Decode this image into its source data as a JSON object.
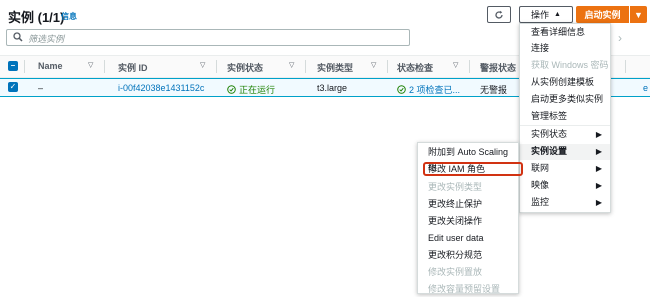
{
  "header": {
    "title": "实例 (1/1)",
    "info": "信息",
    "actions_label": "操作",
    "launch_label": "启动实例"
  },
  "search": {
    "placeholder": "筛选实例"
  },
  "table": {
    "columns": [
      "Name",
      "实例 ID",
      "实例状态",
      "实例类型",
      "状态检查",
      "警报状态"
    ],
    "row": {
      "name": "–",
      "instance_id": "i-00f42038e1431152c",
      "state": "正在运行",
      "type": "t3.large",
      "status_check": "2 项检查已...",
      "alarm": "无警报",
      "extra": "e"
    }
  },
  "actions_menu": [
    {
      "label": "查看详细信息",
      "disabled": false,
      "submenu": false
    },
    {
      "label": "连接",
      "disabled": false,
      "submenu": false
    },
    {
      "label": "获取 Windows 密码",
      "disabled": true,
      "submenu": false
    },
    {
      "label": "从实例创建模板",
      "disabled": false,
      "submenu": false
    },
    {
      "label": "启动更多类似实例",
      "disabled": false,
      "submenu": false
    },
    {
      "label": "管理标签",
      "disabled": false,
      "submenu": false
    },
    {
      "label": "实例状态",
      "disabled": false,
      "submenu": true
    },
    {
      "label": "实例设置",
      "disabled": false,
      "submenu": true,
      "active": true
    },
    {
      "label": "联网",
      "disabled": false,
      "submenu": true
    },
    {
      "label": "映像",
      "disabled": false,
      "submenu": true
    },
    {
      "label": "监控",
      "disabled": false,
      "submenu": true
    }
  ],
  "settings_submenu": [
    {
      "label": "附加到 Auto Scaling 组",
      "disabled": false
    },
    {
      "label": "修改 IAM 角色",
      "disabled": false,
      "highlighted": true
    },
    {
      "label": "更改实例类型",
      "disabled": true
    },
    {
      "label": "更改终止保护",
      "disabled": false
    },
    {
      "label": "更改关闭操作",
      "disabled": false
    },
    {
      "label": "Edit user data",
      "disabled": false
    },
    {
      "label": "更改积分规范",
      "disabled": false
    },
    {
      "label": "修改实例置放",
      "disabled": true
    },
    {
      "label": "修改容量预留设置",
      "disabled": true
    }
  ],
  "colors": {
    "accent": "#ec7211",
    "link": "#0073bb",
    "ok": "#1d8102",
    "highlight": "#d13212"
  }
}
